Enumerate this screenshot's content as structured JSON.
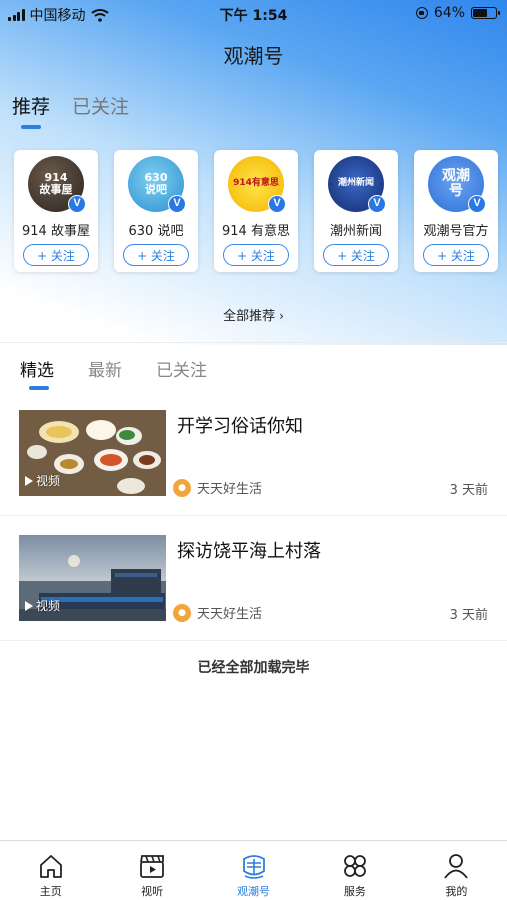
{
  "status_bar": {
    "carrier": "中国移动",
    "time": "下午 1:54",
    "battery": "64%",
    "battery_fraction": 0.64
  },
  "header": {
    "title": "观潮号"
  },
  "top_tabs": [
    {
      "label": "推荐"
    },
    {
      "label": "已关注"
    }
  ],
  "recommended": [
    {
      "name": "914 故事屋",
      "follow": "+ 关注",
      "avatar_text": "914\n故事屋"
    },
    {
      "name": "630 说吧",
      "follow": "+ 关注",
      "avatar_text": "630\n说吧"
    },
    {
      "name": "914 有意思",
      "follow": "+ 关注",
      "avatar_text": "914有意思"
    },
    {
      "name": "潮州新闻",
      "follow": "+ 关注",
      "avatar_text": "潮州新闻"
    },
    {
      "name": "观潮号官方",
      "follow": "+ 关注",
      "avatar_text": "观潮号"
    }
  ],
  "all_recommend": "全部推荐",
  "sub_tabs": [
    {
      "label": "精选"
    },
    {
      "label": "最新"
    },
    {
      "label": "已关注"
    }
  ],
  "articles": [
    {
      "title": "开学习俗话你知",
      "source": "天天好生活",
      "time": "3 天前",
      "tag": "视频"
    },
    {
      "title": "探访饶平海上村落",
      "source": "天天好生活",
      "time": "3 天前",
      "tag": "视频"
    }
  ],
  "end_text": "已经全部加载完毕",
  "bottom_nav": [
    {
      "label": "主页",
      "icon": "home-icon"
    },
    {
      "label": "视听",
      "icon": "clapperboard-icon"
    },
    {
      "label": "观潮号",
      "icon": "guanchao-icon"
    },
    {
      "label": "服务",
      "icon": "services-icon"
    },
    {
      "label": "我的",
      "icon": "person-icon"
    }
  ],
  "colors": {
    "accent": "#2c7fe0",
    "verified": "#2a78e4",
    "source_icon": "#f2a53a"
  }
}
